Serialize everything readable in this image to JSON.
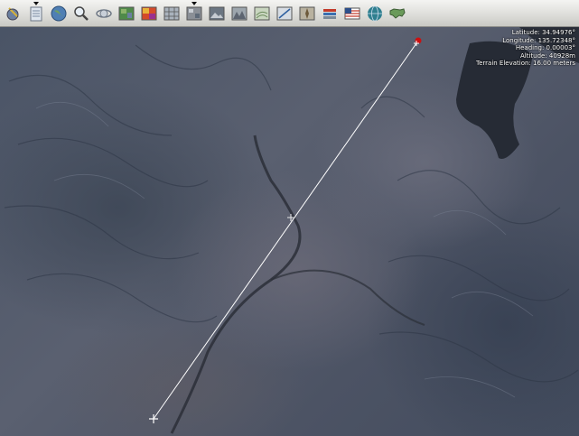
{
  "toolbar": {
    "buttons": [
      {
        "icon": "globe-pointer-icon"
      },
      {
        "icon": "layers-icon",
        "has_dropdown": true
      },
      {
        "icon": "world-icon"
      },
      {
        "icon": "magnifier-icon"
      },
      {
        "icon": "orbit-icon"
      },
      {
        "icon": "landsat-map-icon"
      },
      {
        "icon": "heatmap-icon"
      },
      {
        "icon": "grid-icon"
      },
      {
        "icon": "map-layer-icon",
        "has_dropdown": true
      },
      {
        "icon": "image-layer-icon"
      },
      {
        "icon": "terrain-layer-icon"
      },
      {
        "icon": "topo-layer-icon"
      },
      {
        "icon": "measure-icon"
      },
      {
        "icon": "compass-icon"
      },
      {
        "icon": "stack-icon"
      },
      {
        "icon": "flag-icon"
      },
      {
        "icon": "globe-grid-icon"
      },
      {
        "icon": "us-map-icon"
      }
    ]
  },
  "readout": {
    "latitude": "Latitude: 34.94976°",
    "longitude": "Longitude: 135.72348°",
    "heading": "Heading: 0.00003°",
    "altitude": "Altitude: 40928m",
    "terrain_elevation": "Terrain Elevation: 16.00 meters"
  },
  "colors": {
    "measure_line": "#ffffff",
    "start_marker": "#cc1010"
  }
}
